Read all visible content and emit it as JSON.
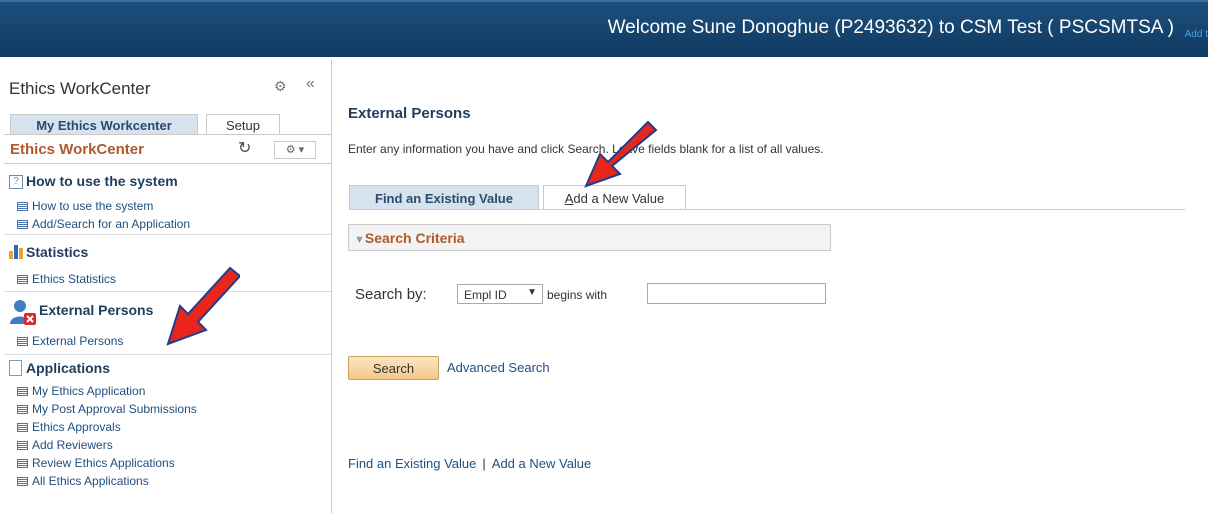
{
  "header": {
    "welcome_text": "Welcome Sune Donoghue (P2493632) to CSM Test ( PSCSMTSA )",
    "add_fav": "Add t"
  },
  "sidebar": {
    "title": "Ethics WorkCenter",
    "tabs": [
      "My Ethics Workcenter",
      "Setup"
    ],
    "header_title": "Ethics WorkCenter",
    "sections": [
      {
        "title": "How to use the system",
        "items": [
          "How to use the system",
          "Add/Search for an Application"
        ]
      },
      {
        "title": "Statistics",
        "items": [
          "Ethics Statistics"
        ]
      },
      {
        "title": "External Persons",
        "items": [
          "External Persons"
        ]
      },
      {
        "title": "Applications",
        "items": [
          "My Ethics Application",
          "My Post Approval Submissions",
          "Ethics Approvals",
          "Add Reviewers",
          "Review Ethics Applications",
          "All Ethics Applications"
        ]
      }
    ]
  },
  "main": {
    "title": "External Persons",
    "instructions": "Enter any information you have and click Search. Leave fields blank for a list of all values.",
    "tabs": {
      "find": "Find an Existing Value",
      "add_prefix": "A",
      "add_rest": "dd a New Value"
    },
    "criteria_title": "Search Criteria",
    "search_by_label": "Search by:",
    "select_value": "Empl ID",
    "begins_with": "begins with",
    "search_button": "Search",
    "advanced_search": "Advanced Search",
    "bottom_links": [
      "Find an Existing Value",
      "Add a New Value"
    ]
  },
  "icons": {
    "arrow_color": "#e8261c",
    "arrow_outline": "#1f3d8c"
  }
}
